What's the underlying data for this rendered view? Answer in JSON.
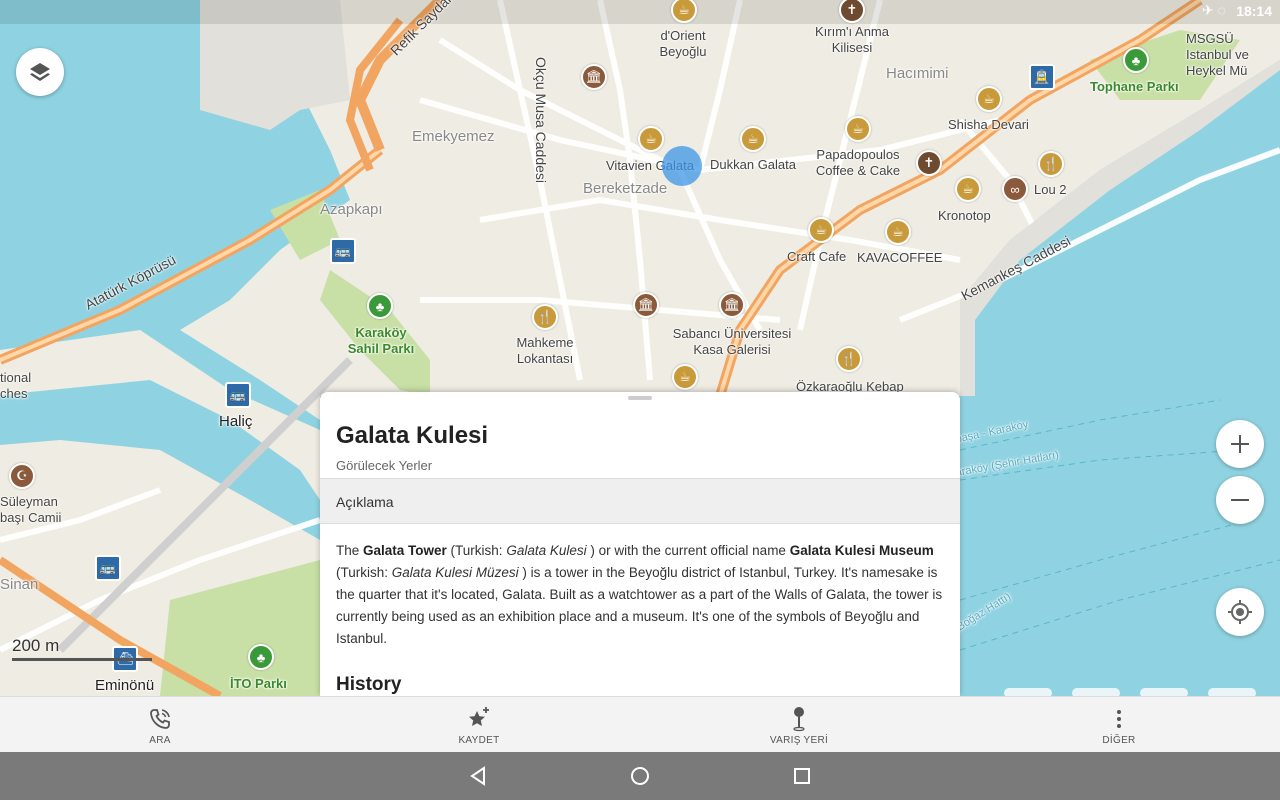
{
  "status": {
    "time": "18:14"
  },
  "map": {
    "areas": [
      {
        "name": "Emekyemez"
      },
      {
        "name": "Azapkapı"
      },
      {
        "name": "Bereketzade"
      },
      {
        "name": "Hacımimi"
      }
    ],
    "streets": [
      "Refik Saydam",
      "Atatürk Köprüsü",
      "Okçu Musa Caddesi",
      "Kemankeş Caddesi"
    ],
    "pois": [
      "d'Orient Beyoğlu",
      "Kırım'ı Anma Kilisesi",
      "Vitavien Galata",
      "Dukkan Galata",
      "Papadopoulos Coffee & Cake",
      "Shisha Devari",
      "Kronotop",
      "Lou 2",
      "Craft Cafe",
      "KAVACOFFEE",
      "Mahkeme Lokantası",
      "Sabancı Üniversitesi Kasa Galerisi",
      "Özkaraoğlu Kebap",
      "Tophane Parkı",
      "MSGSÜ Istanbul ve Heykel Mü",
      "Karaköy Sahil Parkı",
      "Haliç",
      "Eminönü",
      "İTO Parkı",
      "Süleyman başı Camii",
      "Sinan",
      "tional ches"
    ],
    "ferry": [
      "paşa - Karaköy",
      "araköy (Şehir Hatları)",
      "(Boğaz Hattı)"
    ],
    "scale": "200 m"
  },
  "place": {
    "title": "Galata Kulesi",
    "category": "Görülecek Yerler",
    "section": "Açıklama",
    "desc": {
      "p1": "The ",
      "b1": "Galata Tower",
      "p2": " (Turkish: ",
      "i1": "Galata Kulesi",
      "p3": " ) or with the current official name ",
      "b2": "Galata Kulesi Museum",
      "p4": " (Turkish: ",
      "i2": "Galata Kulesi Müzesi",
      "p5": " ) is a tower in the Beyoğlu district of Istanbul, Turkey. It's namesake is the quarter that it's located, Galata. Built as a watchtower as a part of the Walls of Galata, the tower is currently being used as an exhibition place and a museum. It's one of the symbols of Beyoğlu and Istanbul."
    },
    "next_heading": "History"
  },
  "actions": {
    "call": "ARA",
    "save": "KAYDET",
    "dest": "VARIŞ YERİ",
    "more": "DİĞER"
  },
  "colors": {
    "water": "#7fcfe0",
    "land": "#efece3",
    "road_orange": "#f2a560",
    "park": "#c8dfa6",
    "poi_cafe": "#c89a3a",
    "bus": "#2e6aa8"
  }
}
